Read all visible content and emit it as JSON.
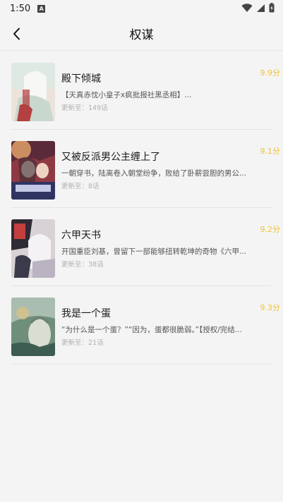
{
  "status": {
    "time": "1:50",
    "a_icon": "A"
  },
  "header": {
    "title": "权谋"
  },
  "books": [
    {
      "title": "殿下倾城",
      "desc": "【天真赤忱小皇子x疯批报社黑丞相】...",
      "update": "更新至：149话",
      "score": "9.9分",
      "cover_colors": [
        "#e8dcd2",
        "#b43a3a",
        "#6f8c7a"
      ]
    },
    {
      "title": "又被反派男公主缠上了",
      "desc": "一朝穿书，陆离卷入朝堂纷争，败给了卧薪尝胆的男公...",
      "update": "更新至：8话",
      "score": "9.1分",
      "cover_colors": [
        "#7a2f3a",
        "#d9a36a",
        "#3a3f6a"
      ]
    },
    {
      "title": "六甲天书",
      "desc": "开国重臣刘基，曾留下一部能够扭转乾坤的奇物《六甲...",
      "update": "更新至：38话",
      "score": "9.2分",
      "cover_colors": [
        "#3a3440",
        "#c84b4b",
        "#c9c3c6"
      ]
    },
    {
      "title": "我是一个蛋",
      "desc": "“为什么是一个蛋？”“因为，蛋都很脆弱。”【授权/完结...",
      "update": "更新至：21话",
      "score": "9.3分",
      "cover_colors": [
        "#5f7e6a",
        "#cfd6c6",
        "#3e5a52"
      ]
    }
  ]
}
